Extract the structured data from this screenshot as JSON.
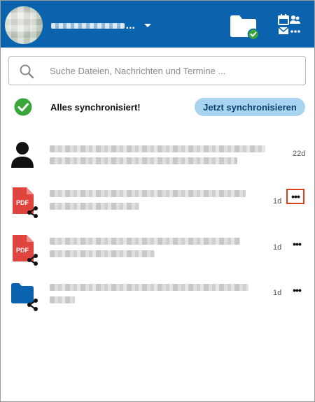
{
  "header": {
    "account_name_ellipsis": "...",
    "icons": {
      "avatar": "user-avatar",
      "chevron": "chevron-down-icon",
      "folder": "folder-synced-icon",
      "apps": "apps-calendar-talk-mail-icon"
    },
    "brand_color": "#0b63ad"
  },
  "search": {
    "placeholder": "Suche Dateien, Nachrichten und Termine ..."
  },
  "status": {
    "text": "Alles synchronisiert!",
    "button_label": "Jetzt synchronisieren",
    "icon": "check-circle-icon",
    "icon_color": "#3aa53a"
  },
  "activities": [
    {
      "type": "user",
      "icon": "user-icon",
      "time": "22d"
    },
    {
      "type": "pdf-shared",
      "icon": "pdf-share-icon",
      "time": "1d",
      "more": "..."
    },
    {
      "type": "pdf-shared",
      "icon": "pdf-share-icon",
      "time": "1d",
      "more": "..."
    },
    {
      "type": "folder-shared",
      "icon": "folder-share-icon",
      "time": "1d",
      "more": "..."
    }
  ],
  "pdf_label": "PDF",
  "highlight_color": "#d9441f"
}
